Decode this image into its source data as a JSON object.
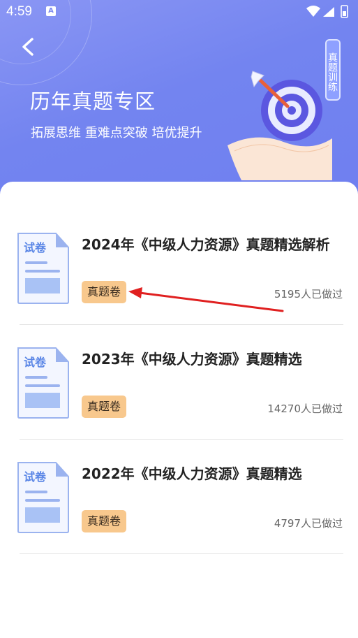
{
  "status_bar": {
    "time": "4:59",
    "notification_letter": "A"
  },
  "header": {
    "title": "历年真题专区",
    "subtitle": "拓展思维 重难点突破 培优提升",
    "side_tag": "真题训练"
  },
  "items": [
    {
      "doc_label": "试卷",
      "title": "2024年《中级人力资源》真题精选解析",
      "badge": "真题卷",
      "count": "5195人已做过"
    },
    {
      "doc_label": "试卷",
      "title": "2023年《中级人力资源》真题精选",
      "badge": "真题卷",
      "count": "14270人已做过"
    },
    {
      "doc_label": "试卷",
      "title": "2022年《中级人力资源》真题精选",
      "badge": "真题卷",
      "count": "4797人已做过"
    }
  ],
  "colors": {
    "header_gradient": "#7384f0",
    "badge": "#f8c88d",
    "arrow": "#e02020"
  }
}
